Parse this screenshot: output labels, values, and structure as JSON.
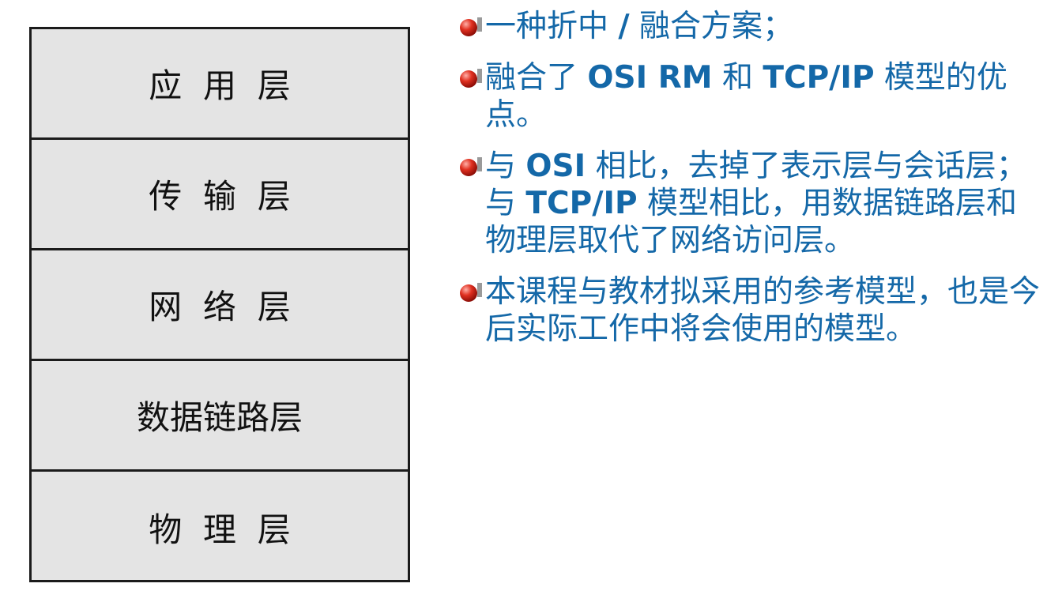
{
  "layers": [
    {
      "label": "应  用  层"
    },
    {
      "label": "传  输  层"
    },
    {
      "label": "网  络  层"
    },
    {
      "label": "数据链路层"
    },
    {
      "label": "物  理  层"
    }
  ],
  "bullets": [
    {
      "parts": [
        {
          "text": "一种折中 ",
          "bold": false
        },
        {
          "text": "/",
          "bold": true
        },
        {
          "text": " 融合方案；",
          "bold": false
        }
      ]
    },
    {
      "parts": [
        {
          "text": "融合了 ",
          "bold": false
        },
        {
          "text": "OSI RM",
          "bold": true
        },
        {
          "text": " 和 ",
          "bold": false
        },
        {
          "text": "TCP/IP",
          "bold": true
        },
        {
          "text": " 模型的优点。",
          "bold": false
        }
      ]
    },
    {
      "parts": [
        {
          "text": "与 ",
          "bold": false
        },
        {
          "text": "OSI",
          "bold": true
        },
        {
          "text": " 相比，去掉了表示层与会话层；与 ",
          "bold": false
        },
        {
          "text": "TCP/IP",
          "bold": true
        },
        {
          "text": " 模型相比，用数据链路层和物理层取代了网络访问层。",
          "bold": false
        }
      ]
    },
    {
      "parts": [
        {
          "text": "本课程与教材拟采用的参考模型，也是今后实际工作中将会使用的模型。",
          "bold": false
        }
      ]
    }
  ],
  "colors": {
    "bullet_text": "#1468a8",
    "layer_fill": "#e4e4e4",
    "bullet_marker": "#c0201a"
  },
  "icons": {
    "bullet_marker": "red-ball-bullet-icon"
  }
}
